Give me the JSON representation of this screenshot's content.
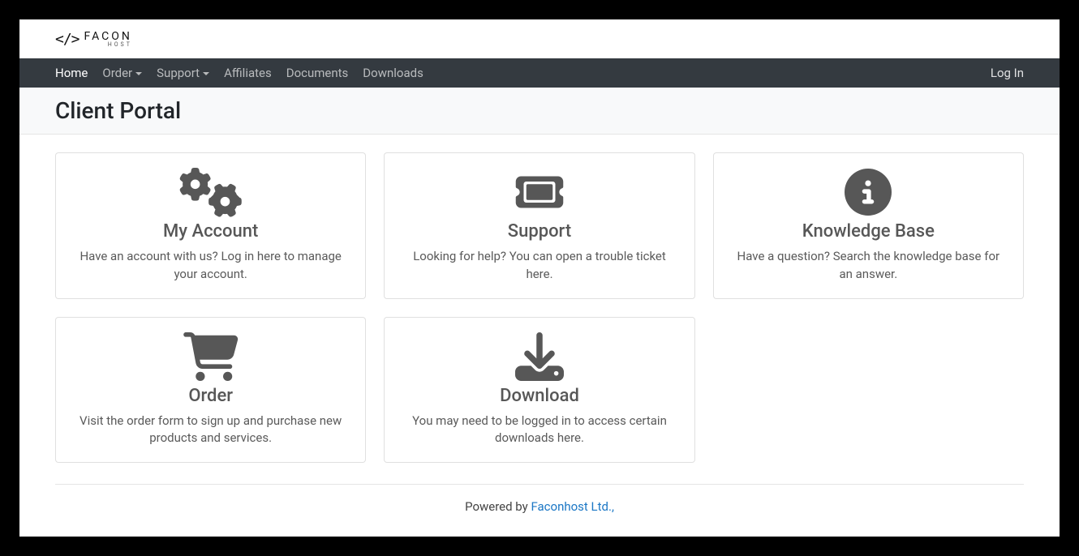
{
  "logo": {
    "mark": "</>",
    "brand": "FACON",
    "sub": "HOST"
  },
  "nav": {
    "items": [
      {
        "label": "Home",
        "active": true,
        "dropdown": false
      },
      {
        "label": "Order",
        "active": false,
        "dropdown": true
      },
      {
        "label": "Support",
        "active": false,
        "dropdown": true
      },
      {
        "label": "Affiliates",
        "active": false,
        "dropdown": false
      },
      {
        "label": "Documents",
        "active": false,
        "dropdown": false
      },
      {
        "label": "Downloads",
        "active": false,
        "dropdown": false
      }
    ],
    "login": "Log In"
  },
  "page": {
    "title": "Client Portal"
  },
  "cards": {
    "myaccount": {
      "title": "My Account",
      "desc": "Have an account with us? Log in here to manage your account."
    },
    "support": {
      "title": "Support",
      "desc": "Looking for help? You can open a trouble ticket here."
    },
    "knowledge": {
      "title": "Knowledge Base",
      "desc": "Have a question? Search the knowledge base for an answer."
    },
    "order": {
      "title": "Order",
      "desc": "Visit the order form to sign up and purchase new products and services."
    },
    "download": {
      "title": "Download",
      "desc": "You may need to be logged in to access certain downloads here."
    }
  },
  "footer": {
    "prefix": "Powered by ",
    "link": "Faconhost Ltd.,"
  }
}
